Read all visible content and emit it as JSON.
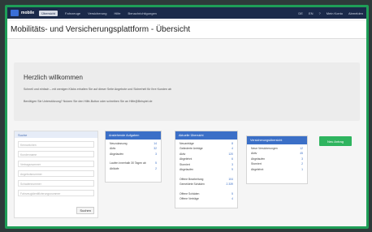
{
  "topbar": {
    "logo": "mobile",
    "nav": [
      {
        "label": "Übersicht",
        "active": true
      },
      {
        "label": "Fahrzeuge",
        "active": false
      },
      {
        "label": "Versicherung",
        "active": false
      },
      {
        "label": "Hilfe",
        "active": false
      },
      {
        "label": "Benachrichtigungen",
        "active": false
      }
    ],
    "right_items": [
      "DE",
      "EN",
      "?",
      "Mein Konto",
      "Abmelden"
    ]
  },
  "page": {
    "title": "Mobilitäts- und Versicherungsplattform - Übersicht"
  },
  "welcome": {
    "heading": "Herzlich willkommen",
    "line1": "Schnell und einfach – mit wenigen Klicks erhalten Sie auf dieser Seite Angebote und Sicherheit für Ihre Kunden ab",
    "line2": "Benötigen Sie Unterstützung? Nutzen Sie den Hilfe-Button oder schreiben Sie an Hilfe@Beispiel.de"
  },
  "form": {
    "heading": "Suche",
    "fields": [
      "Kennzeichen",
      "Kundenname",
      "Vertragsnummer",
      "Angebotsnummer",
      "Schadennummer",
      "Fahrzeugidentifizierungsnummer"
    ],
    "button": "Suchen"
  },
  "card1": {
    "title": "Anstehende Aufgaben",
    "rows": [
      {
        "label": "Neuzulassung",
        "value": "14"
      },
      {
        "label": "Aktiv",
        "value": "32"
      },
      {
        "label": "Abgelaufen",
        "value": "3"
      }
    ],
    "rows2": [
      {
        "label": "Laufen innerhalb 30 Tagen ab",
        "value": "5"
      },
      {
        "label": "Abläufe",
        "value": "2"
      }
    ]
  },
  "card2": {
    "title": "Aktuelle Übersicht",
    "rows": [
      {
        "label": "Neuanträge",
        "value": "8"
      },
      {
        "label": "Geänderte Anträge",
        "value": "4"
      },
      {
        "label": "Aktiv",
        "value": "120"
      },
      {
        "label": "Abgelehnt",
        "value": "6"
      },
      {
        "label": "Storniert",
        "value": "3"
      },
      {
        "label": "Abgelaufen",
        "value": "9"
      }
    ],
    "rows2": [
      {
        "label": "Offene Bearbeitung",
        "value": "104"
      },
      {
        "label": "Gemeldete Schäden",
        "value": "2.339"
      }
    ],
    "rows3": [
      {
        "label": "Offene Schäden",
        "value": "5"
      },
      {
        "label": "Offene Verträge",
        "value": "4"
      }
    ]
  },
  "card3": {
    "title": "Versicherungsübersicht",
    "rows": [
      {
        "label": "Neue Versicherungen",
        "value": "12"
      },
      {
        "label": "Aktiv",
        "value": "45"
      },
      {
        "label": "Abgelaufen",
        "value": "3"
      },
      {
        "label": "Storniert",
        "value": "2"
      },
      {
        "label": "Abgelehnt",
        "value": "1"
      }
    ]
  },
  "new_button": "Neu Antrag"
}
